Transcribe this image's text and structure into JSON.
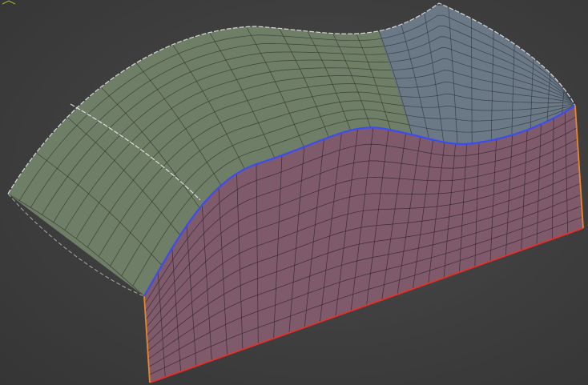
{
  "viewport": {
    "background": "#404040",
    "gizmo_icon": "axis-tripod-icon"
  },
  "mesh": {
    "top_surface": {
      "face_color": "#6f7e66",
      "wire_color": "#2b3129"
    },
    "right_surface": {
      "face_color": "#6b7885",
      "wire_color": "#2a3038"
    },
    "front_face": {
      "face_color": "#7e5a6b",
      "wire_color": "#2e2028"
    },
    "grid": {
      "cols": 22,
      "rows": 12,
      "front_cols": 28,
      "front_rows": 11
    }
  },
  "edges": {
    "selected_curve_color": "#3b4cf2",
    "bottom_edge_color": "#e8302a",
    "side_edge_color": "#e8862a",
    "seam_color": "#f2f2f2"
  }
}
